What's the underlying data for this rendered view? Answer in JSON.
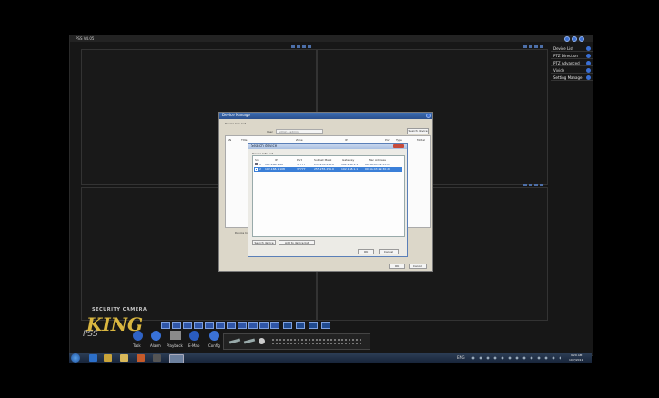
{
  "app": {
    "title": "PSS  V4.05"
  },
  "sidebar": {
    "items": [
      {
        "label": "Device List"
      },
      {
        "label": "PTZ Direction"
      },
      {
        "label": "PTZ Advanced"
      },
      {
        "label": "Vivide"
      },
      {
        "label": "Setting Manage"
      }
    ]
  },
  "device_manage": {
    "title": "Device Manage",
    "group_label": "Device Info List",
    "user_label": "User",
    "user_value": "admin - admin",
    "search_button": "Search device",
    "columns": [
      "SN",
      "Title",
      "Zone",
      "IP",
      "Port",
      "Type",
      "Model"
    ],
    "info_label": "Device Information",
    "ok_button": "OK",
    "cancel_button": "Cancel"
  },
  "search_device": {
    "title": "Search device",
    "group_label": "Device Info List",
    "columns": [
      "Sn",
      "IP",
      "Port",
      "Subnet Mask",
      "Gateway",
      "Mac Address"
    ],
    "rows": [
      {
        "sn": "1",
        "ip": "192.168.1.80",
        "port": "37777",
        "mask": "255.255.255.0",
        "gateway": "192.168.1.1",
        "mac": "00:9A:43:F9:33:15"
      },
      {
        "sn": "2",
        "ip": "192.168.1.108",
        "port": "37777",
        "mask": "255.255.255.0",
        "gateway": "192.168.1.1",
        "mac": "00:9A:43:29:30:20"
      }
    ],
    "search_button": "Search device",
    "add_button": "Add to device list",
    "ok_button": "OK",
    "cancel_button": "Cancel"
  },
  "toolbar": {
    "buttons": [
      {
        "label": "Task"
      },
      {
        "label": "Alarm"
      },
      {
        "label": "Playback"
      },
      {
        "label": "E-Map"
      },
      {
        "label": "Config"
      }
    ]
  },
  "logo": {
    "line1": "SECURITY CAMERA",
    "line2": "KING",
    "sub": "PSS"
  },
  "taskbar": {
    "lang": "ENG",
    "time": "9:29 AM",
    "date": "10/7/2011"
  },
  "colors": {
    "accent_blue": "#3a6fd3",
    "arrow": "#d01818",
    "selected_row": "#3a7fd8"
  }
}
